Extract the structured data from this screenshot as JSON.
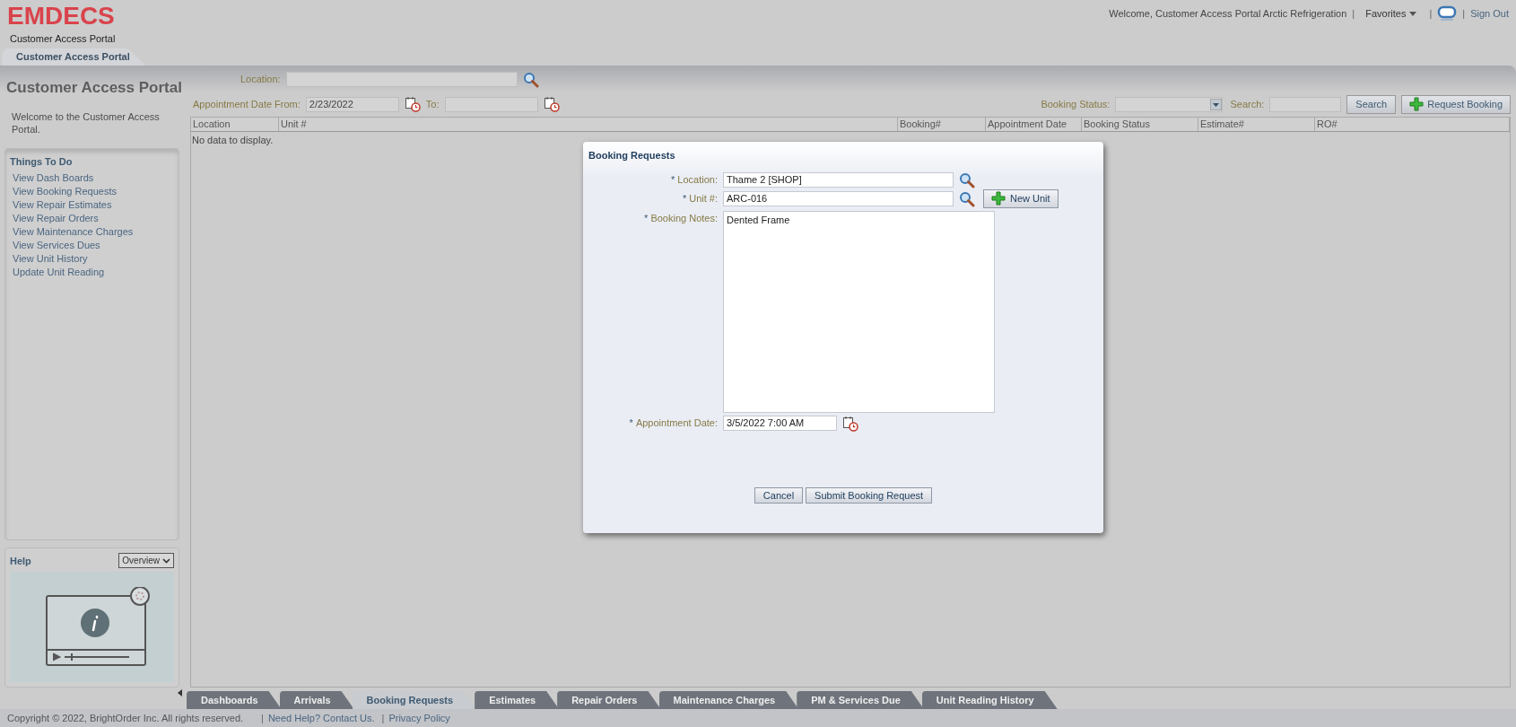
{
  "header": {
    "logo": "EMDECS",
    "subtitle": "Customer Access Portal",
    "tab": {
      "label": "Customer Access Portal",
      "selected": true
    },
    "welcome": "Welcome, Customer Access Portal Arctic Refrigeration",
    "separator": "|",
    "favorites": "Favorites",
    "sign_out": "Sign Out"
  },
  "sidebar": {
    "title": "Customer Access Portal",
    "welcome": "Welcome to the Customer Access Portal.",
    "things_to_do": {
      "title": "Things To Do",
      "items": [
        "View Dash Boards",
        "View Booking Requests",
        "View Repair Estimates",
        "View Repair Orders",
        "View Maintenance Charges",
        "View Services Dues",
        "View Unit History",
        "Update Unit Reading"
      ]
    },
    "help": {
      "title": "Help",
      "dropdown": "Overview"
    }
  },
  "filters": {
    "location_label": "Location:",
    "date_from_label": "Appointment Date From:",
    "date_from": "2/23/2022",
    "to_label": "To:",
    "booking_status_label": "Booking Status:",
    "search_label": "Search:",
    "search_button": "Search",
    "request_button": "Request Booking"
  },
  "table": {
    "columns": [
      "Location",
      "Unit #",
      "Booking#",
      "Appointment Date",
      "Booking Status",
      "Estimate#",
      "RO#"
    ],
    "empty_text": "No data to display."
  },
  "dialog": {
    "title": "Booking Requests",
    "fields": [
      {
        "kind": "lookup",
        "required_mark": "*",
        "label": "Location:",
        "value": "Thame 2 [SHOP]"
      },
      {
        "kind": "lookup",
        "required_mark": "*",
        "label": "Unit #:",
        "value": "ARC-016",
        "button": "New Unit"
      },
      {
        "kind": "textarea",
        "required_mark": "*",
        "label": "Booking Notes:",
        "value": "Dented Frame"
      },
      {
        "kind": "date",
        "required_mark": "*",
        "label": "Appointment Date:",
        "value": "3/5/2022 7:00 AM"
      }
    ],
    "buttons": [
      "Cancel",
      "Submit Booking Request"
    ]
  },
  "bottom_tabs": [
    {
      "label": "Dashboards",
      "selected": false
    },
    {
      "label": "Arrivals",
      "selected": false
    },
    {
      "label": "Booking Requests",
      "selected": true
    },
    {
      "label": "Estimates",
      "selected": false
    },
    {
      "label": "Repair Orders",
      "selected": false
    },
    {
      "label": "Maintenance Charges",
      "selected": false
    },
    {
      "label": "PM & Services Due",
      "selected": false
    },
    {
      "label": "Unit Reading History",
      "selected": false
    }
  ],
  "footer": {
    "copyright": "Copyright © 2022, BrightOrder Inc. All rights reserved.",
    "separator": "|",
    "links": [
      "Need Help? Contact Us.",
      "Privacy Policy"
    ]
  }
}
